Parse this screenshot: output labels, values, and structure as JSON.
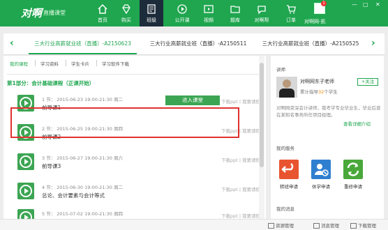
{
  "app": {
    "logo": "对啊",
    "logo_sub": "直播课堂"
  },
  "window_controls": [
    "—",
    "▢",
    "✕"
  ],
  "nav": [
    {
      "label": "首页",
      "icon": "home-icon"
    },
    {
      "label": "购买",
      "icon": "diamond-icon"
    },
    {
      "label": "班级",
      "icon": "class-icon"
    },
    {
      "label": "公开课",
      "icon": "play-circle-icon"
    },
    {
      "label": "视频",
      "icon": "video-icon"
    },
    {
      "label": "题库",
      "icon": "folder-icon"
    },
    {
      "label": "对啊帮",
      "icon": "dui-a-help-icon"
    },
    {
      "label": "订单",
      "icon": "cart-icon"
    }
  ],
  "user": {
    "name": "对啊网-凯",
    "badge": "1"
  },
  "class_tabs": [
    {
      "label": "三大行业高薪就业班（直播）-A2150623"
    },
    {
      "label": "三大行业高薪就业班（直播）-A2150511"
    },
    {
      "label": "三大行业高薪就业班（直播）-A2150525"
    }
  ],
  "subtabs": [
    "我的课程",
    "学习资料",
    "学生卡片",
    "学习软件下载"
  ],
  "section_title": "第1部分：会计基础课程（正课开始）",
  "lessons": [
    {
      "meta": "1 节：   2015-06-23  19:00-21:30    周二",
      "name": "前导课1",
      "links": "下载ppt  |  我要请假"
    },
    {
      "meta": "2 节：   2015-06-25  19:00-21:30    周四",
      "name": "前导课2",
      "links": "下载ppt  |  我要请假"
    },
    {
      "meta": "3 节：   2015-06-27  19:00-21:30    周六",
      "name": "前导课3",
      "links": "下载ppt  |  我要请假"
    },
    {
      "meta": "4 节：   2015-06-30  19:00-21:30    周二",
      "name": "总论、会计要素与会计等式",
      "links": "下载ppt  |  我要请假"
    },
    {
      "meta": "5 节：   2015-07-02  19:00-21:30    周四",
      "name": "",
      "links": "下载ppt  |  我要请假"
    }
  ],
  "enter_button": "进入课堂",
  "sidebar": {
    "teacher_heading": "讲师",
    "teacher_name": "对啊网东子老师",
    "follow": "+关注",
    "stat_prefix": "累计指导",
    "stat_num": "32",
    "stat_suffix": "个学生",
    "bio": "对啊网资深会计讲师，我考学专业毕业生，毕业后曾在某知名事务所任项目经理。",
    "view_intro": "查看详细介绍",
    "services_heading": "我的服务",
    "services": [
      {
        "label": "转班申请",
        "color": "#e8542f",
        "icon": "transfer-icon"
      },
      {
        "label": "休学申请",
        "color": "#2f7fd0",
        "icon": "suspend-icon"
      },
      {
        "label": "重修申请",
        "color": "#4aa83a",
        "icon": "retake-icon"
      }
    ],
    "messages_heading": "我的消息"
  },
  "footer": [
    {
      "label": "资源管理",
      "icon": "folder-icon"
    },
    {
      "label": "消息管理",
      "icon": "message-icon"
    },
    {
      "label": "下载管理",
      "icon": "download-icon"
    }
  ],
  "colors": {
    "brand": "#1fa64f",
    "nav_active": "#1d2c3a",
    "highlight": "#e03030"
  }
}
